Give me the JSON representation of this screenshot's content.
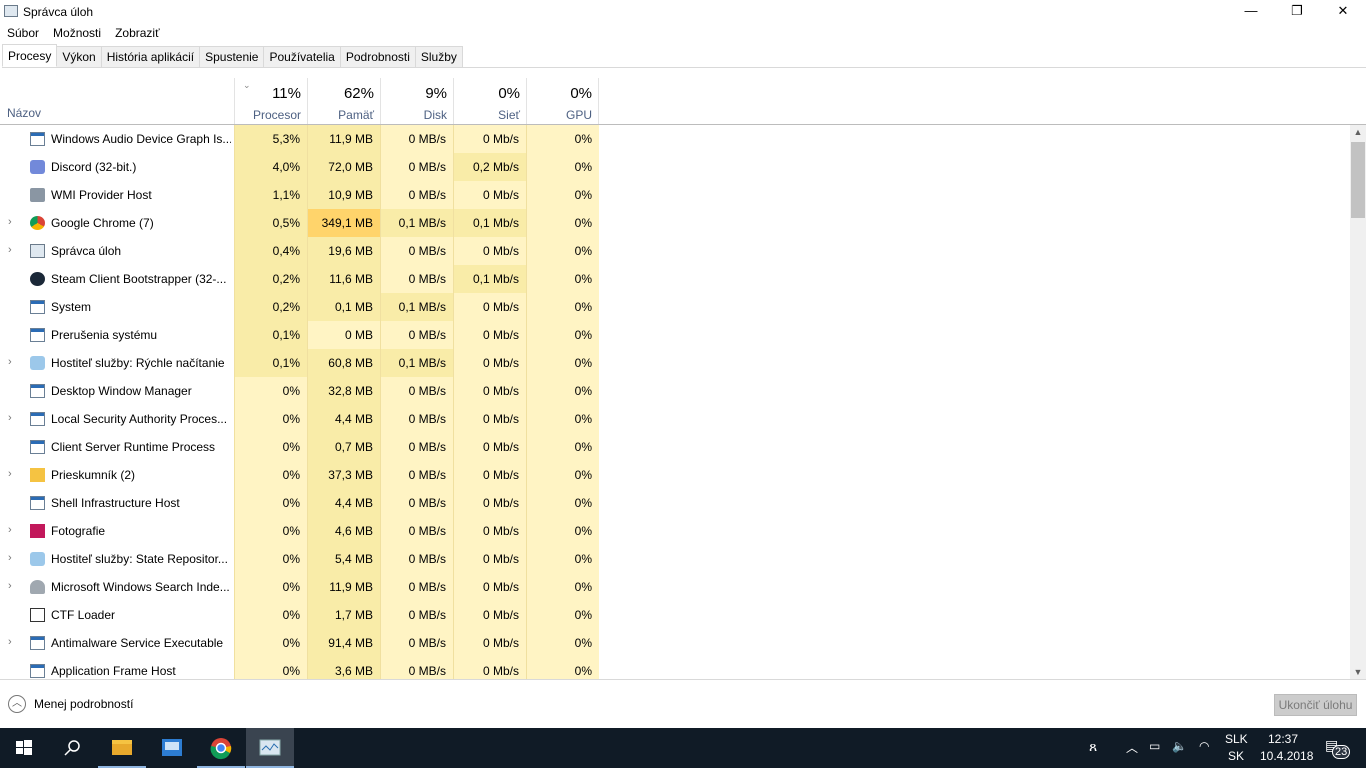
{
  "window": {
    "title": "Správca úloh",
    "minimize": "—",
    "restore": "❐",
    "close": "✕"
  },
  "menu": [
    "Súbor",
    "Možnosti",
    "Zobraziť"
  ],
  "tabs": [
    "Procesy",
    "Výkon",
    "História aplikácií",
    "Spustenie",
    "Používatelia",
    "Podrobnosti",
    "Služby"
  ],
  "columns": {
    "name": "Názov",
    "cpu": {
      "pct": "11%",
      "label": "Procesor"
    },
    "mem": {
      "pct": "62%",
      "label": "Pamäť"
    },
    "disk": {
      "pct": "9%",
      "label": "Disk"
    },
    "net": {
      "pct": "0%",
      "label": "Sieť"
    },
    "gpu": {
      "pct": "0%",
      "label": "GPU"
    }
  },
  "rows": [
    {
      "name": "Windows Audio Device Graph Is...",
      "icon": "window-icon",
      "exp": false,
      "v": [
        "5,3%",
        "11,9 MB",
        "0 MB/s",
        "0 Mb/s",
        "0%"
      ],
      "h": [
        1,
        1,
        0,
        0,
        0
      ]
    },
    {
      "name": "Discord (32-bit.)",
      "icon": "discord-icon",
      "exp": false,
      "v": [
        "4,0%",
        "72,0 MB",
        "0 MB/s",
        "0,2 Mb/s",
        "0%"
      ],
      "h": [
        1,
        1,
        0,
        1,
        0
      ]
    },
    {
      "name": "WMI Provider Host",
      "icon": "wmi-icon",
      "exp": false,
      "v": [
        "1,1%",
        "10,9 MB",
        "0 MB/s",
        "0 Mb/s",
        "0%"
      ],
      "h": [
        1,
        1,
        0,
        0,
        0
      ]
    },
    {
      "name": "Google Chrome (7)",
      "icon": "chrome-icon",
      "exp": true,
      "v": [
        "0,5%",
        "349,1 MB",
        "0,1 MB/s",
        "0,1 Mb/s",
        "0%"
      ],
      "h": [
        1,
        2,
        1,
        1,
        0
      ]
    },
    {
      "name": "Správca úloh",
      "icon": "task-manager-icon",
      "exp": true,
      "v": [
        "0,4%",
        "19,6 MB",
        "0 MB/s",
        "0 Mb/s",
        "0%"
      ],
      "h": [
        1,
        1,
        0,
        0,
        0
      ]
    },
    {
      "name": "Steam Client Bootstrapper (32-...",
      "icon": "steam-icon",
      "exp": false,
      "v": [
        "0,2%",
        "11,6 MB",
        "0 MB/s",
        "0,1 Mb/s",
        "0%"
      ],
      "h": [
        1,
        1,
        0,
        1,
        0
      ]
    },
    {
      "name": "System",
      "icon": "window-icon",
      "exp": false,
      "v": [
        "0,2%",
        "0,1 MB",
        "0,1 MB/s",
        "0 Mb/s",
        "0%"
      ],
      "h": [
        1,
        1,
        1,
        0,
        0
      ]
    },
    {
      "name": "Prerušenia systému",
      "icon": "window-icon",
      "exp": false,
      "v": [
        "0,1%",
        "0 MB",
        "0 MB/s",
        "0 Mb/s",
        "0%"
      ],
      "h": [
        1,
        0,
        0,
        0,
        0
      ]
    },
    {
      "name": "Hostiteľ služby: Rýchle načítanie",
      "icon": "gear-icon",
      "exp": true,
      "v": [
        "0,1%",
        "60,8 MB",
        "0,1 MB/s",
        "0 Mb/s",
        "0%"
      ],
      "h": [
        1,
        1,
        1,
        0,
        0
      ]
    },
    {
      "name": "Desktop Window Manager",
      "icon": "window-icon",
      "exp": false,
      "v": [
        "0%",
        "32,8 MB",
        "0 MB/s",
        "0 Mb/s",
        "0%"
      ],
      "h": [
        0,
        1,
        0,
        0,
        0
      ]
    },
    {
      "name": "Local Security Authority Proces...",
      "icon": "window-icon",
      "exp": true,
      "v": [
        "0%",
        "4,4 MB",
        "0 MB/s",
        "0 Mb/s",
        "0%"
      ],
      "h": [
        0,
        1,
        0,
        0,
        0
      ]
    },
    {
      "name": "Client Server Runtime Process",
      "icon": "window-icon",
      "exp": false,
      "v": [
        "0%",
        "0,7 MB",
        "0 MB/s",
        "0 Mb/s",
        "0%"
      ],
      "h": [
        0,
        1,
        0,
        0,
        0
      ]
    },
    {
      "name": "Prieskumník (2)",
      "icon": "folder-icon",
      "exp": true,
      "v": [
        "0%",
        "37,3 MB",
        "0 MB/s",
        "0 Mb/s",
        "0%"
      ],
      "h": [
        0,
        1,
        0,
        0,
        0
      ]
    },
    {
      "name": "Shell Infrastructure Host",
      "icon": "window-icon",
      "exp": false,
      "v": [
        "0%",
        "4,4 MB",
        "0 MB/s",
        "0 Mb/s",
        "0%"
      ],
      "h": [
        0,
        1,
        0,
        0,
        0
      ]
    },
    {
      "name": "Fotografie",
      "icon": "photos-icon",
      "exp": true,
      "v": [
        "0%",
        "4,6 MB",
        "0 MB/s",
        "0 Mb/s",
        "0%"
      ],
      "h": [
        0,
        1,
        0,
        0,
        0
      ]
    },
    {
      "name": "Hostiteľ služby: State Repositor...",
      "icon": "gear-icon",
      "exp": true,
      "v": [
        "0%",
        "5,4 MB",
        "0 MB/s",
        "0 Mb/s",
        "0%"
      ],
      "h": [
        0,
        1,
        0,
        0,
        0
      ]
    },
    {
      "name": "Microsoft Windows Search Inde...",
      "icon": "search-indexer-icon",
      "exp": true,
      "v": [
        "0%",
        "11,9 MB",
        "0 MB/s",
        "0 Mb/s",
        "0%"
      ],
      "h": [
        0,
        1,
        0,
        0,
        0
      ]
    },
    {
      "name": "CTF Loader",
      "icon": "ctf-icon",
      "exp": false,
      "v": [
        "0%",
        "1,7 MB",
        "0 MB/s",
        "0 Mb/s",
        "0%"
      ],
      "h": [
        0,
        1,
        0,
        0,
        0
      ]
    },
    {
      "name": "Antimalware Service Executable",
      "icon": "window-icon",
      "exp": true,
      "v": [
        "0%",
        "91,4 MB",
        "0 MB/s",
        "0 Mb/s",
        "0%"
      ],
      "h": [
        0,
        1,
        0,
        0,
        0
      ]
    },
    {
      "name": "Application Frame Host",
      "icon": "window-icon",
      "exp": false,
      "v": [
        "0%",
        "3,6 MB",
        "0 MB/s",
        "0 Mb/s",
        "0%"
      ],
      "h": [
        0,
        1,
        0,
        0,
        0
      ]
    }
  ],
  "footer": {
    "less": "Menej podrobností",
    "end_task": "Ukončiť úlohu"
  },
  "tray": {
    "lang1": "SLK",
    "lang2": "SK",
    "time": "12:37",
    "date": "10.4.2018",
    "notifications": "23"
  }
}
